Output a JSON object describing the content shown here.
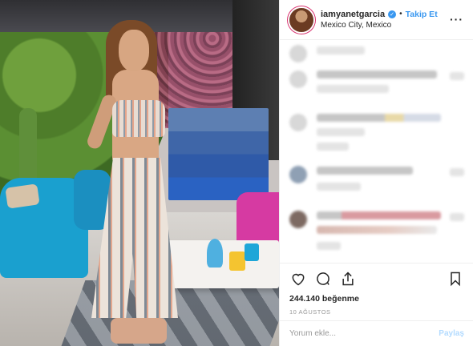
{
  "post": {
    "username": "iamyanetgarcia",
    "separator": "•",
    "follow_label": "Takip Et",
    "location": "Mexico City, Mexico",
    "more_glyph": "···",
    "verified_glyph": "✓"
  },
  "engagement": {
    "likes_text": "244.140 beğenme",
    "date_text": "10 AĞUSTOS"
  },
  "comment_box": {
    "placeholder": "Yorum ekle...",
    "post_label": "Paylaş"
  },
  "colors": {
    "accent_blue": "#3897f0",
    "post_disabled": "#b3dbff",
    "story_ring": "#d9326f"
  },
  "icons": [
    "heart-icon",
    "comment-icon",
    "share-icon",
    "bookmark-icon",
    "verified-icon",
    "more-options-icon"
  ]
}
